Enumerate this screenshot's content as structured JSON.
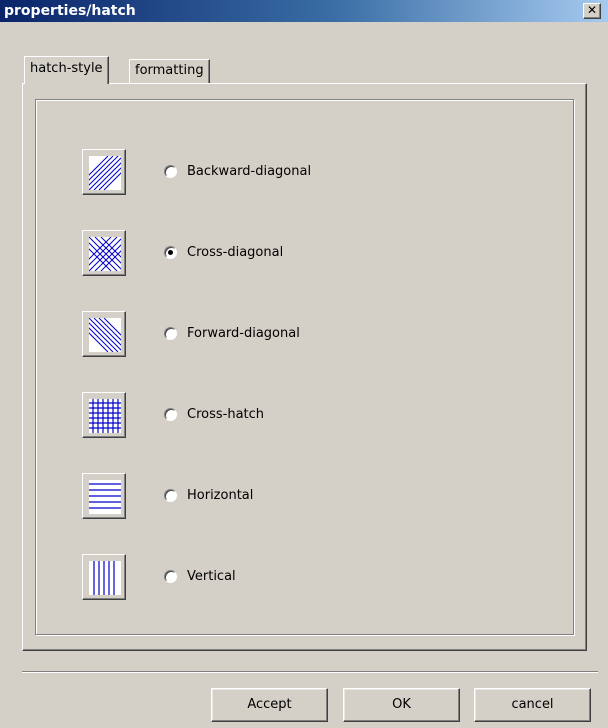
{
  "window": {
    "title": "properties/hatch",
    "close_glyph": "✕"
  },
  "tabs": [
    {
      "label": "hatch-style",
      "active": true
    },
    {
      "label": "formatting",
      "active": false
    }
  ],
  "hatch_options": [
    {
      "label": "Backward-diagonal",
      "icon": "backward-diagonal-hatch-icon",
      "selected": false
    },
    {
      "label": "Cross-diagonal",
      "icon": "cross-diagonal-hatch-icon",
      "selected": true
    },
    {
      "label": "Forward-diagonal",
      "icon": "forward-diagonal-hatch-icon",
      "selected": false
    },
    {
      "label": "Cross-hatch",
      "icon": "cross-hatch-icon",
      "selected": false
    },
    {
      "label": "Horizontal",
      "icon": "horizontal-hatch-icon",
      "selected": false
    },
    {
      "label": "Vertical",
      "icon": "vertical-hatch-icon",
      "selected": false
    }
  ],
  "buttons": {
    "accept": "Accept",
    "ok": "OK",
    "cancel": "cancel"
  },
  "colors": {
    "hatch_line": "#0000cc",
    "swatch_bg": "#ffffff",
    "titlebar_start": "#0a246a",
    "titlebar_end": "#a6caf0"
  }
}
